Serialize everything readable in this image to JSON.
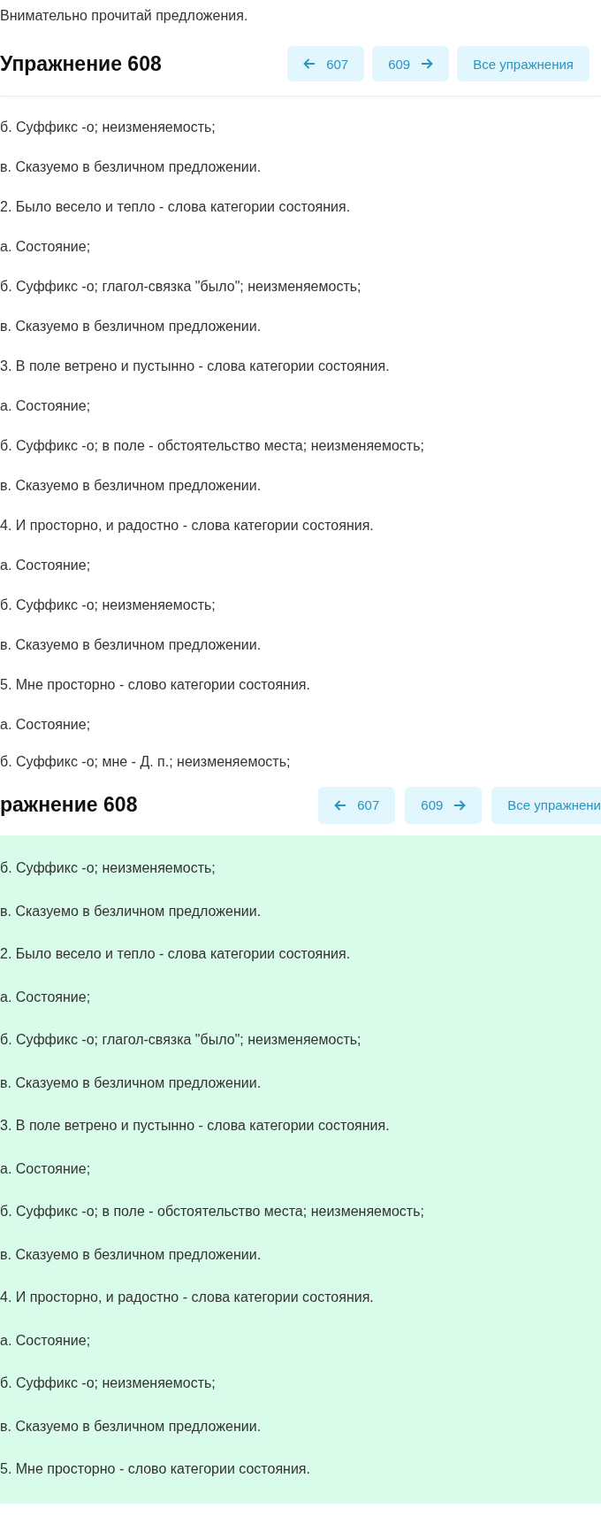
{
  "intro": "Внимательно прочитай предложения.",
  "header": {
    "title": "Упражнение 608",
    "buttons": [
      {
        "kind": "prev",
        "label": "607"
      },
      {
        "kind": "next",
        "label": "609"
      },
      {
        "kind": "all",
        "label": "Все упражнения"
      }
    ]
  },
  "answer_lines": [
    "б. Суффикс -о; неизменяемость;",
    "в. Сказуемо в безличном предложении.",
    "2. Было весело и тепло - слова категории состояния.",
    "а. Состояние;",
    "б. Суффикс -о; глагол-связка \"было\"; неизменяемость;",
    "в. Сказуемо в безличном предложении.",
    "3. В поле ветрено и пустынно - слова категории состояния.",
    "а. Состояние;",
    "б. Суффикс -о; в поле - обстоятельство места; неизменяемость;",
    "в. Сказуемо в безличном предложении.",
    "4. И просторно, и радостно - слова категории состояния.",
    "а. Состояние;",
    "б. Суффикс -о; неизменяемость;",
    "в. Сказуемо в безличном предложении.",
    "5. Мне просторно - слово категории состояния.",
    "а. Состояние;",
    "б. Суффикс -о; мне - Д. п.; неизменяемость;"
  ],
  "header_2": {
    "title": "ражнение 608",
    "buttons": [
      {
        "kind": "prev",
        "label": "607"
      },
      {
        "kind": "next",
        "label": "609"
      },
      {
        "kind": "all",
        "label": "Все упражнени"
      }
    ]
  },
  "answer_lines_2": [
    "б. Суффикс -о; неизменяемость;",
    "в. Сказуемо в безличном предложении.",
    "2. Было весело и тепло - слова категории состояния.",
    "а. Состояние;",
    "б. Суффикс -о; глагол-связка \"было\"; неизменяемость;",
    "в. Сказуемо в безличном предложении.",
    "3. В поле ветрено и пустынно - слова категории состояния.",
    "а. Состояние;",
    "б. Суффикс -о; в поле - обстоятельство места; неизменяемость;",
    "в. Сказуемо в безличном предложении.",
    "4. И просторно, и радостно - слова категории состояния.",
    "а. Состояние;",
    "б. Суффикс -о; неизменяемость;",
    "в. Сказуемо в безличном предложении.",
    "5. Мне просторно - слово категории состояния."
  ]
}
